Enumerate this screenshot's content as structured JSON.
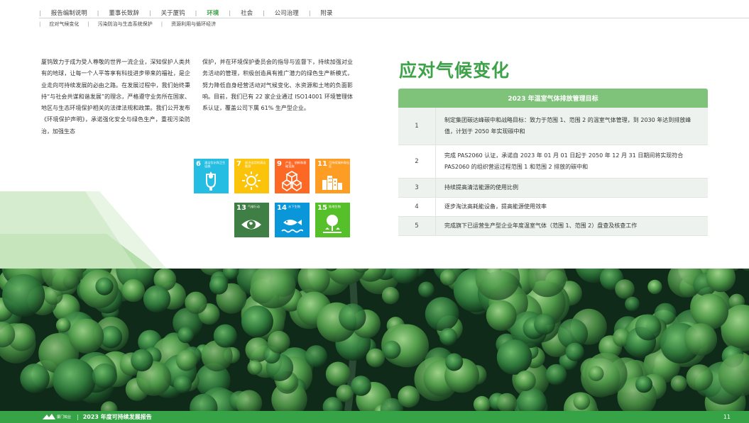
{
  "nav": {
    "items": [
      "报告编制说明",
      "董事长致辞",
      "关于厦钨",
      "环境",
      "社会",
      "公司治理",
      "附录"
    ],
    "active_index": 3,
    "sub_items": [
      "应对气候变化",
      "污染防治与生态系统保护",
      "资源利用与循环经济"
    ]
  },
  "body": {
    "col1": "厦钨致力于成为受人尊敬的世界一流企业，深知保护人类共有的地球，让每一个人平等享有科技进步带来的福祉，是企业走向可持续发展的必由之路。在发展过程中，我们始终秉持“与社会共谋和谐发展”的理念，严格遵守业务所在国家、地区与生态环境保护相关的法律法规和政策。我们公开发布《环境保护声明》，承诺强化安全与绿色生产，重视污染防治，加强生态",
    "col2": "保护，并在环境保护委员会的指导与监督下，持续加强对业务活动的管理，积极创造具有推广潜力的绿色生产新模式，努力降低自身经营活动对气候变化、水资源和土地的负面影响。目前，我们已有 22 家企业通过 ISO14001 环境管理体系认证，覆盖公司下属 61% 生产型企业。"
  },
  "sdgs": [
    {
      "num": "6",
      "label": "清洁饮水和卫生设施",
      "color": "#26bde2",
      "icon": "water-drop-icon"
    },
    {
      "num": "7",
      "label": "经济适用的清洁能源",
      "color": "#fcc30b",
      "icon": "sun-icon"
    },
    {
      "num": "9",
      "label": "产业、创新和基础设施",
      "color": "#fd6925",
      "icon": "cubes-icon"
    },
    {
      "num": "11",
      "label": "可持续城市和社区",
      "color": "#fd9d24",
      "icon": "city-icon"
    },
    {
      "num": "13",
      "label": "气候行动",
      "color": "#3f7e44",
      "icon": "eye-globe-icon"
    },
    {
      "num": "14",
      "label": "水下生物",
      "color": "#0a97d9",
      "icon": "fish-icon"
    },
    {
      "num": "15",
      "label": "陆地生物",
      "color": "#56c02b",
      "icon": "tree-icon"
    }
  ],
  "heading": "应对气候变化",
  "table": {
    "title": "2023 年温室气体排放管理目标",
    "rows": [
      {
        "idx": "1",
        "text": "制定集团碳达峰碳中和战略目标：致力于范围 1、范围 2 的温室气体管理，到 2030 年达到排放峰值，计划于 2050 年实现碳中和"
      },
      {
        "idx": "2",
        "text": "完成 PAS2060 认证，承诺自 2023 年 01 月 01 日起于 2050 年 12 月 31 日期间将实现符合 PAS2060 的组织营运过程范围 1 和范围 2 排放的碳中和"
      },
      {
        "idx": "3",
        "text": "持续提高清洁能源的使用比例"
      },
      {
        "idx": "4",
        "text": "逐步淘汰高耗能设备，提高能源使用效率"
      },
      {
        "idx": "5",
        "text": "完成旗下已运营生产型企业年度温室气体（范围 1、范围 2）盘查及核查工作"
      }
    ]
  },
  "footer": {
    "logo_text": "厦门钨业",
    "title": "2023 年度可持续发展报告",
    "page": "11"
  },
  "colors": {
    "brand_green": "#3ea24a",
    "footer_green": "#36a346",
    "table_head": "#7fc27a"
  }
}
